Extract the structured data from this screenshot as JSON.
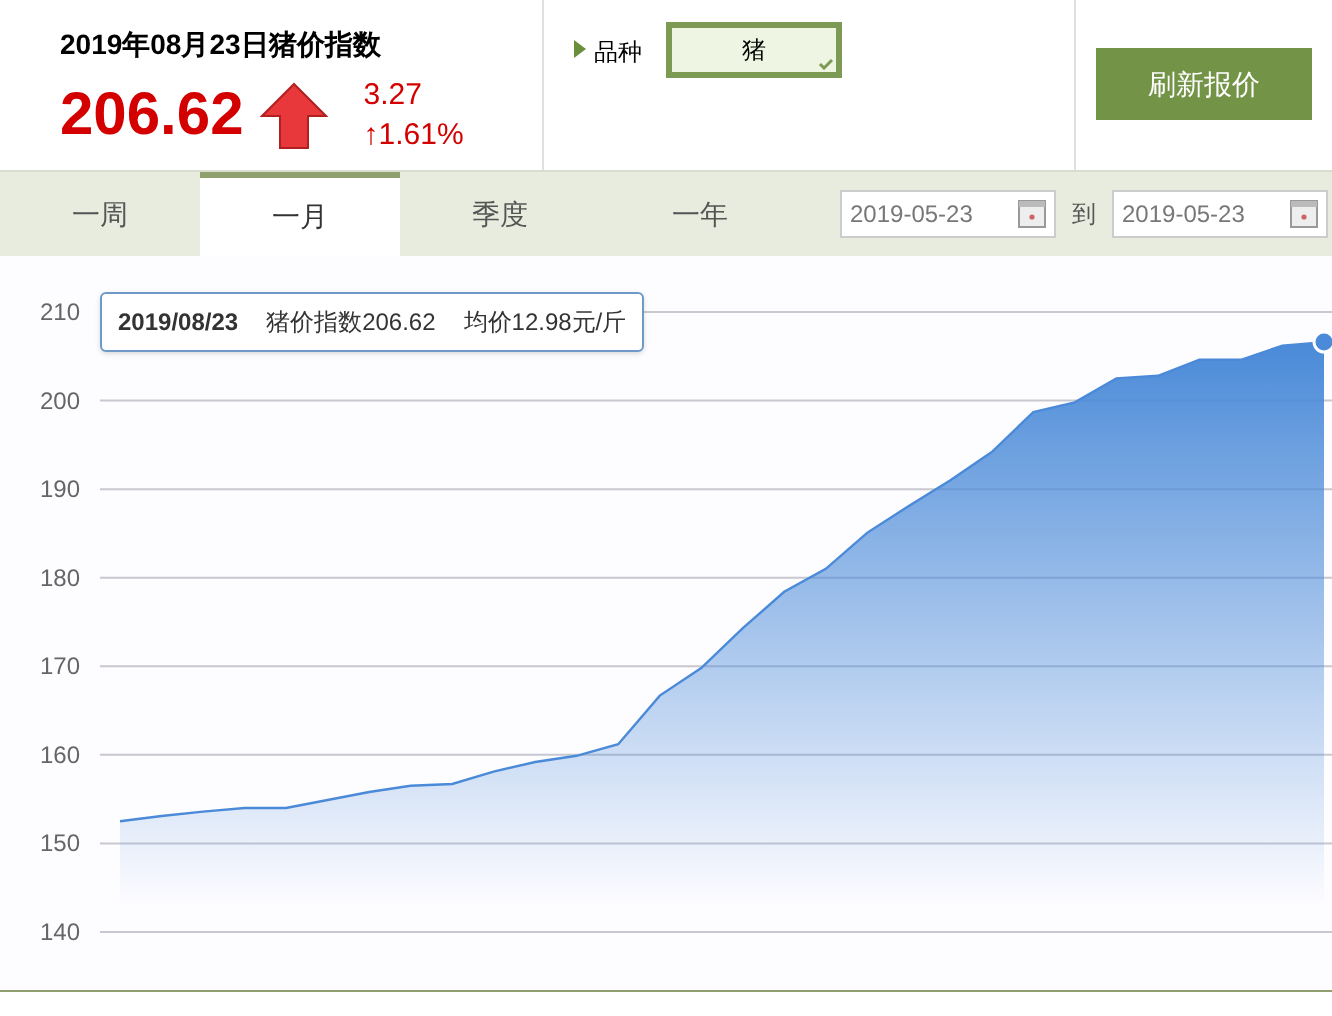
{
  "header": {
    "title": "2019年08月23日猪价指数",
    "index": "206.62",
    "change": "3.27",
    "change_pct": "↑1.61%"
  },
  "variety": {
    "label": "品种",
    "value": "猪"
  },
  "refresh_button": "刷新报价",
  "tabs": [
    {
      "label": "一周",
      "selected": false
    },
    {
      "label": "一月",
      "selected": true
    },
    {
      "label": "季度",
      "selected": false
    },
    {
      "label": "一年",
      "selected": false
    }
  ],
  "date_range": {
    "from": "2019-05-23",
    "separator": "到",
    "to": "2019-05-23"
  },
  "chart": {
    "tooltip": {
      "date": "2019/08/23",
      "index_text": "猪价指数206.62",
      "price_text": "均价12.98元/斤"
    },
    "chart_data": {
      "type": "area",
      "grid": true,
      "ylim": [
        140,
        210
      ],
      "yticks": [
        140,
        150,
        160,
        170,
        180,
        190,
        200,
        210
      ],
      "series": [
        {
          "color": "#4a8ad8",
          "values": [
            152.5,
            153.1,
            153.6,
            154.0,
            154.0,
            154.9,
            155.8,
            156.5,
            156.7,
            158.1,
            159.2,
            159.9,
            161.2,
            166.7,
            169.8,
            174.3,
            178.4,
            181.0,
            185.1,
            188.1,
            191.0,
            194.2,
            198.7,
            199.8,
            202.5,
            202.8,
            204.6,
            204.6,
            206.2,
            206.6
          ]
        }
      ]
    }
  }
}
